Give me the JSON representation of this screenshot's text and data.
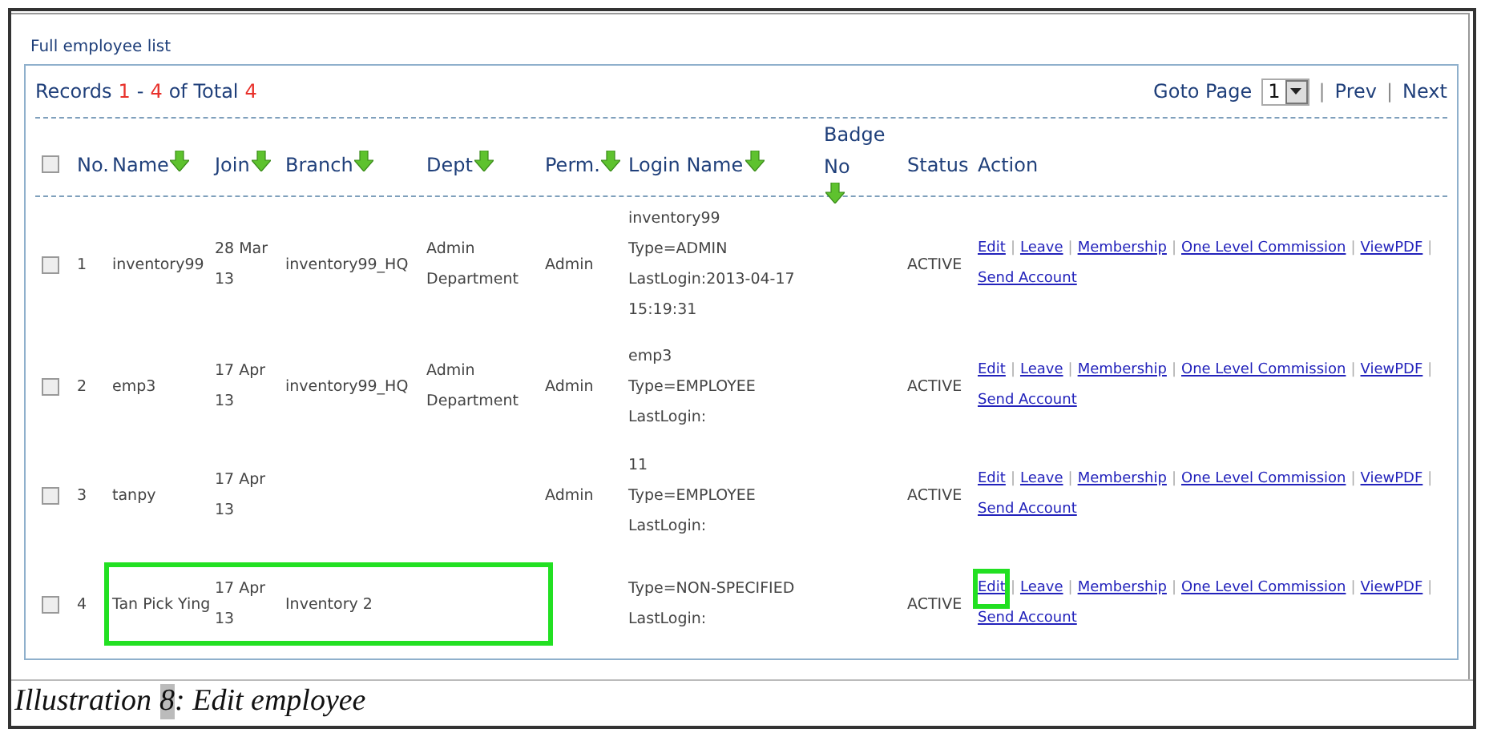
{
  "page_link": "Full employee list",
  "records": {
    "label": "Records",
    "from": "1",
    "dash": "-",
    "to": "4",
    "of": "of Total",
    "total": "4"
  },
  "pager": {
    "label": "Goto Page",
    "page": "1",
    "separator": "|",
    "prev": "Prev",
    "next": "Next"
  },
  "header_checkbox": {
    "checked": false
  },
  "columns": [
    {
      "label": "No.",
      "sortable": false
    },
    {
      "label": "Name",
      "sortable": true
    },
    {
      "label": "Join",
      "sortable": true
    },
    {
      "label": "Branch",
      "sortable": true
    },
    {
      "label": "Dept",
      "sortable": true
    },
    {
      "label": "Perm.",
      "sortable": true
    },
    {
      "label": "Login Name",
      "sortable": true
    },
    {
      "label": "Badge No",
      "sortable": true
    },
    {
      "label": "Status",
      "sortable": false
    },
    {
      "label": "Action",
      "sortable": false
    }
  ],
  "action_separator": "|",
  "rows": [
    {
      "checked": false,
      "no": "1",
      "name": "inventory99",
      "join": "28 Mar 13",
      "branch": "inventory99_HQ",
      "dept": "Admin Department",
      "perm": "Admin",
      "login": [
        "inventory99",
        "Type=ADMIN",
        "LastLogin:2013-04-17 15:19:31"
      ],
      "status": "ACTIVE",
      "actions": [
        "Edit",
        "Leave",
        "Membership",
        "One Level Commission",
        "ViewPDF",
        "Send Account"
      ],
      "highlight": false,
      "edit_highlight": false
    },
    {
      "checked": false,
      "no": "2",
      "name": "emp3",
      "join": "17 Apr 13",
      "branch": "inventory99_HQ",
      "dept": "Admin Department",
      "perm": "Admin",
      "login": [
        "emp3",
        "Type=EMPLOYEE",
        "LastLogin:"
      ],
      "status": "ACTIVE",
      "actions": [
        "Edit",
        "Leave",
        "Membership",
        "One Level Commission",
        "ViewPDF",
        "Send Account"
      ],
      "highlight": false,
      "edit_highlight": false
    },
    {
      "checked": false,
      "no": "3",
      "name": "tanpy",
      "join": "17 Apr 13",
      "perm": "Admin",
      "login": [
        "11",
        "Type=EMPLOYEE",
        "LastLogin:"
      ],
      "status": "ACTIVE",
      "actions": [
        "Edit",
        "Leave",
        "Membership",
        "One Level Commission",
        "ViewPDF",
        "Send Account"
      ],
      "highlight": false,
      "edit_highlight": false
    },
    {
      "checked": false,
      "no": "4",
      "name": "Tan Pick Ying",
      "join": "17 Apr 13",
      "branch": "Inventory 2",
      "login": [
        "Type=NON-SPECIFIED",
        "LastLogin:"
      ],
      "status": "ACTIVE",
      "actions": [
        "Edit",
        "Leave",
        "Membership",
        "One Level Commission",
        "ViewPDF",
        "Send Account"
      ],
      "highlight": true,
      "edit_highlight": true
    }
  ],
  "caption": {
    "label": "Illustration",
    "number": "8",
    "text": ": Edit employee"
  }
}
